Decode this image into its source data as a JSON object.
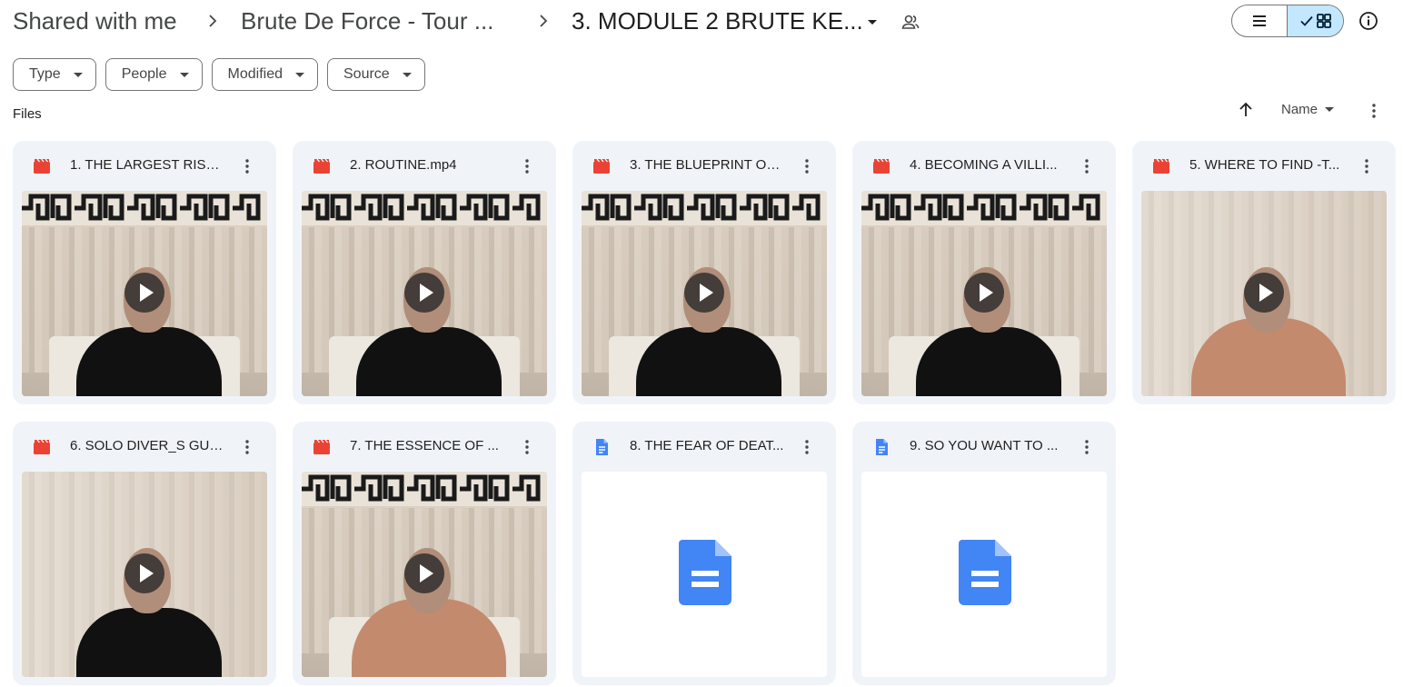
{
  "breadcrumb": {
    "root": "Shared with me",
    "parent": "Brute De Force - Tour ...",
    "current": "3. MODULE 2 BRUTE KE..."
  },
  "filters": [
    {
      "label": "Type"
    },
    {
      "label": "People"
    },
    {
      "label": "Modified"
    },
    {
      "label": "Source"
    }
  ],
  "section": {
    "label": "Files"
  },
  "sort": {
    "label": "Name"
  },
  "files": [
    {
      "title": "1. THE LARGEST RISK ...",
      "kind": "video",
      "icon": "video-file-icon"
    },
    {
      "title": "2. ROUTINE.mp4",
      "kind": "video",
      "icon": "video-file-icon"
    },
    {
      "title": "3. THE BLUEPRINT OF...",
      "kind": "video",
      "icon": "video-file-icon"
    },
    {
      "title": "4. BECOMING A VILLI...",
      "kind": "video",
      "icon": "video-file-icon"
    },
    {
      "title": "5. WHERE TO FIND -T...",
      "kind": "video",
      "icon": "video-file-icon"
    },
    {
      "title": "6. SOLO DIVER_S GUI...",
      "kind": "video",
      "icon": "video-file-icon"
    },
    {
      "title": "7. THE ESSENCE OF ...",
      "kind": "video",
      "icon": "video-file-icon"
    },
    {
      "title": "8. THE FEAR OF DEAT...",
      "kind": "doc",
      "icon": "docs-file-icon"
    },
    {
      "title": "9. SO YOU WANT TO ...",
      "kind": "doc",
      "icon": "docs-file-icon"
    }
  ],
  "colors": {
    "card_bg": "#f0f4f9",
    "video_red": "#ea4335",
    "docs_blue": "#4285f4",
    "toggle_active": "#c2e7ff"
  }
}
